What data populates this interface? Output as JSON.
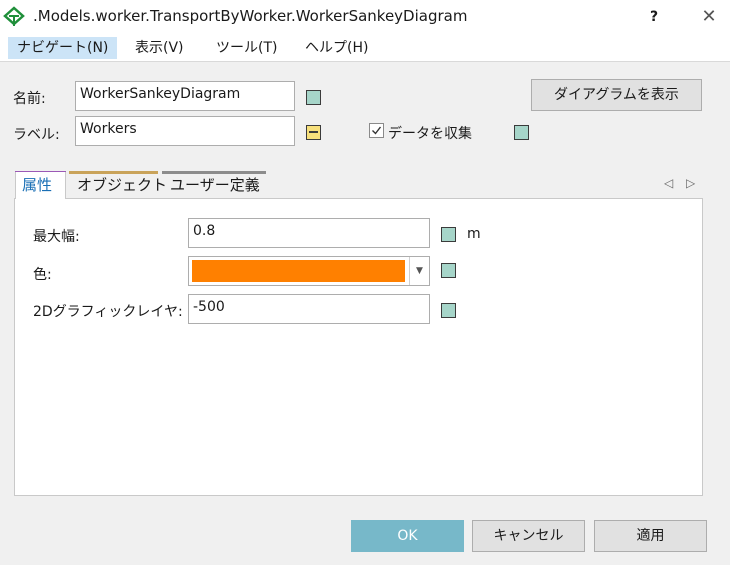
{
  "window": {
    "title": ".Models.worker.TransportByWorker.WorkerSankeyDiagram",
    "help": "?",
    "close": "✕"
  },
  "menu": [
    {
      "label": "ナビゲート(N)"
    },
    {
      "label": "表示(V)"
    },
    {
      "label": "ツール(T)"
    },
    {
      "label": "ヘルプ(H)"
    }
  ],
  "header": {
    "name_label": "名前:",
    "name_value": "WorkerSankeyDiagram",
    "label_label": "ラベル:",
    "label_value": "Workers",
    "show_diagram_button": "ダイアグラムを表示",
    "collect_data_label": "データを収集",
    "collect_data_checked": true
  },
  "tabs": [
    {
      "label": "属性",
      "accent": "#9b59b6"
    },
    {
      "label": "オブジェクト",
      "accent": "#c9a35a"
    },
    {
      "label": "ユーザー定義",
      "accent": "#8c8c8c"
    }
  ],
  "tab_nav": {
    "prev": "◁",
    "next": "▷"
  },
  "properties": {
    "max_width_label": "最大幅:",
    "max_width_value": "0.8",
    "max_width_unit": "m",
    "color_label": "色:",
    "color_value": "#ff8000",
    "layer_label": "2Dグラフィックレイヤ:",
    "layer_value": "-500"
  },
  "footer": {
    "ok": "OK",
    "cancel": "キャンセル",
    "apply": "適用"
  }
}
